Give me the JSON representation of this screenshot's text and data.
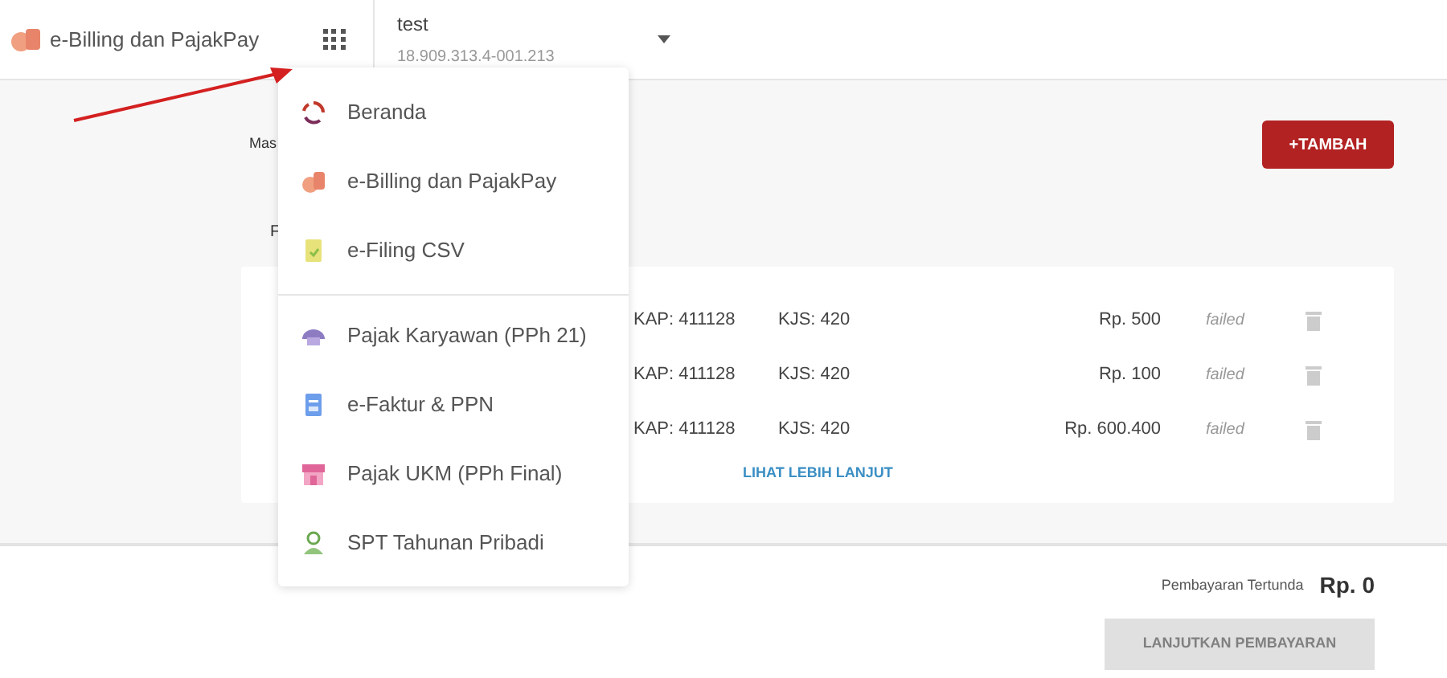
{
  "header": {
    "app_name": "e-Billing dan PajakPay",
    "account": {
      "name": "test",
      "npwp": "18.909.313.4-001.213"
    }
  },
  "content": {
    "section_label": "Mas",
    "list_label": "F",
    "add_button": "+TAMBAH",
    "rows": [
      {
        "kap": "KAP: 411128",
        "kjs": "KJS: 420",
        "amount": "Rp. 500",
        "status": "failed"
      },
      {
        "kap": "KAP: 411128",
        "kjs": "KJS: 420",
        "amount": "Rp. 100",
        "status": "failed"
      },
      {
        "kap": "KAP: 411128",
        "kjs": "KJS: 420",
        "amount": "Rp. 600.400",
        "status": "failed"
      }
    ],
    "more_link": "LIHAT LEBIH LANJUT"
  },
  "footer": {
    "pending_label": "Pembayaran Tertunda",
    "pending_amount": "Rp. 0",
    "continue_button": {
      "label": "LANJUTKAN PEMBAYARAN",
      "disabled": true
    }
  },
  "app_menu": {
    "groups": [
      {
        "items": [
          {
            "label": "Beranda",
            "kind": "home"
          },
          {
            "label": "e-Billing dan PajakPay",
            "kind": "billing"
          },
          {
            "label": "e-Filing CSV",
            "kind": "filing"
          }
        ]
      },
      {
        "items": [
          {
            "label": "Pajak Karyawan (PPh 21)",
            "kind": "employee"
          },
          {
            "label": "e-Faktur & PPN",
            "kind": "invoice"
          },
          {
            "label": "Pajak UKM (PPh Final)",
            "kind": "shop"
          },
          {
            "label": "SPT Tahunan Pribadi",
            "kind": "person"
          }
        ]
      }
    ]
  }
}
